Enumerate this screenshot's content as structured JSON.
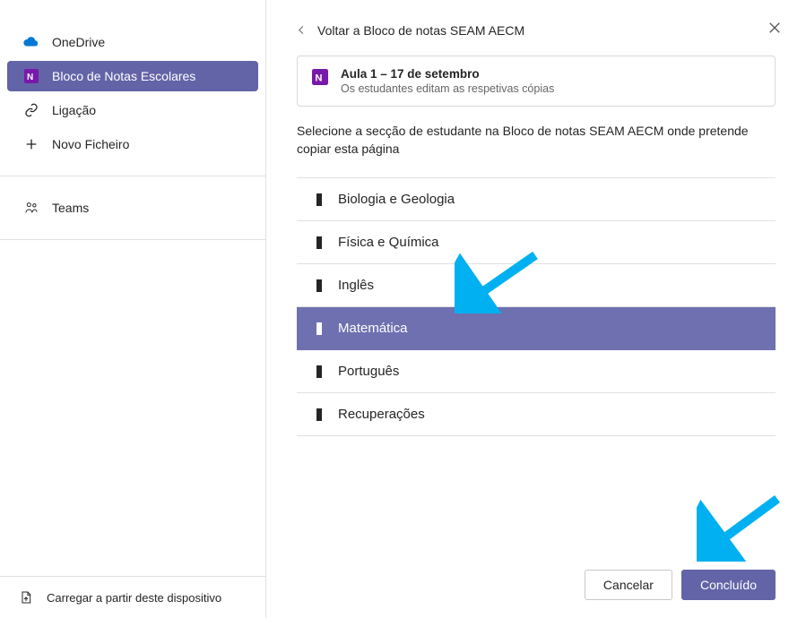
{
  "sidebar": {
    "items": [
      {
        "label": "OneDrive",
        "icon": "onedrive-icon",
        "selected": false
      },
      {
        "label": "Bloco de Notas Escolares",
        "icon": "onenote-icon",
        "selected": true
      },
      {
        "label": "Ligação",
        "icon": "link-icon",
        "selected": false
      },
      {
        "label": "Novo Ficheiro",
        "icon": "plus-icon",
        "selected": false
      }
    ],
    "teams": "Teams",
    "footer": "Carregar a partir deste dispositivo"
  },
  "main": {
    "back_label": "Voltar a Bloco de notas SEAM AECM",
    "note_card": {
      "title": "Aula 1 – 17 de setembro",
      "subtitle": "Os estudantes editam as respetivas cópias"
    },
    "instruction": "Selecione a secção de estudante na Bloco de notas SEAM AECM onde pretende copiar esta página",
    "sections": [
      {
        "label": "Biologia e Geologia",
        "selected": false
      },
      {
        "label": "Física e Química",
        "selected": false
      },
      {
        "label": "Inglês",
        "selected": false
      },
      {
        "label": "Matemática",
        "selected": true
      },
      {
        "label": "Português",
        "selected": false
      },
      {
        "label": "Recuperações",
        "selected": false
      }
    ],
    "buttons": {
      "cancel": "Cancelar",
      "done": "Concluído"
    }
  },
  "colors": {
    "accent": "#6264a7",
    "accent_light": "#6e70b0",
    "annotation": "#00b0f0"
  }
}
